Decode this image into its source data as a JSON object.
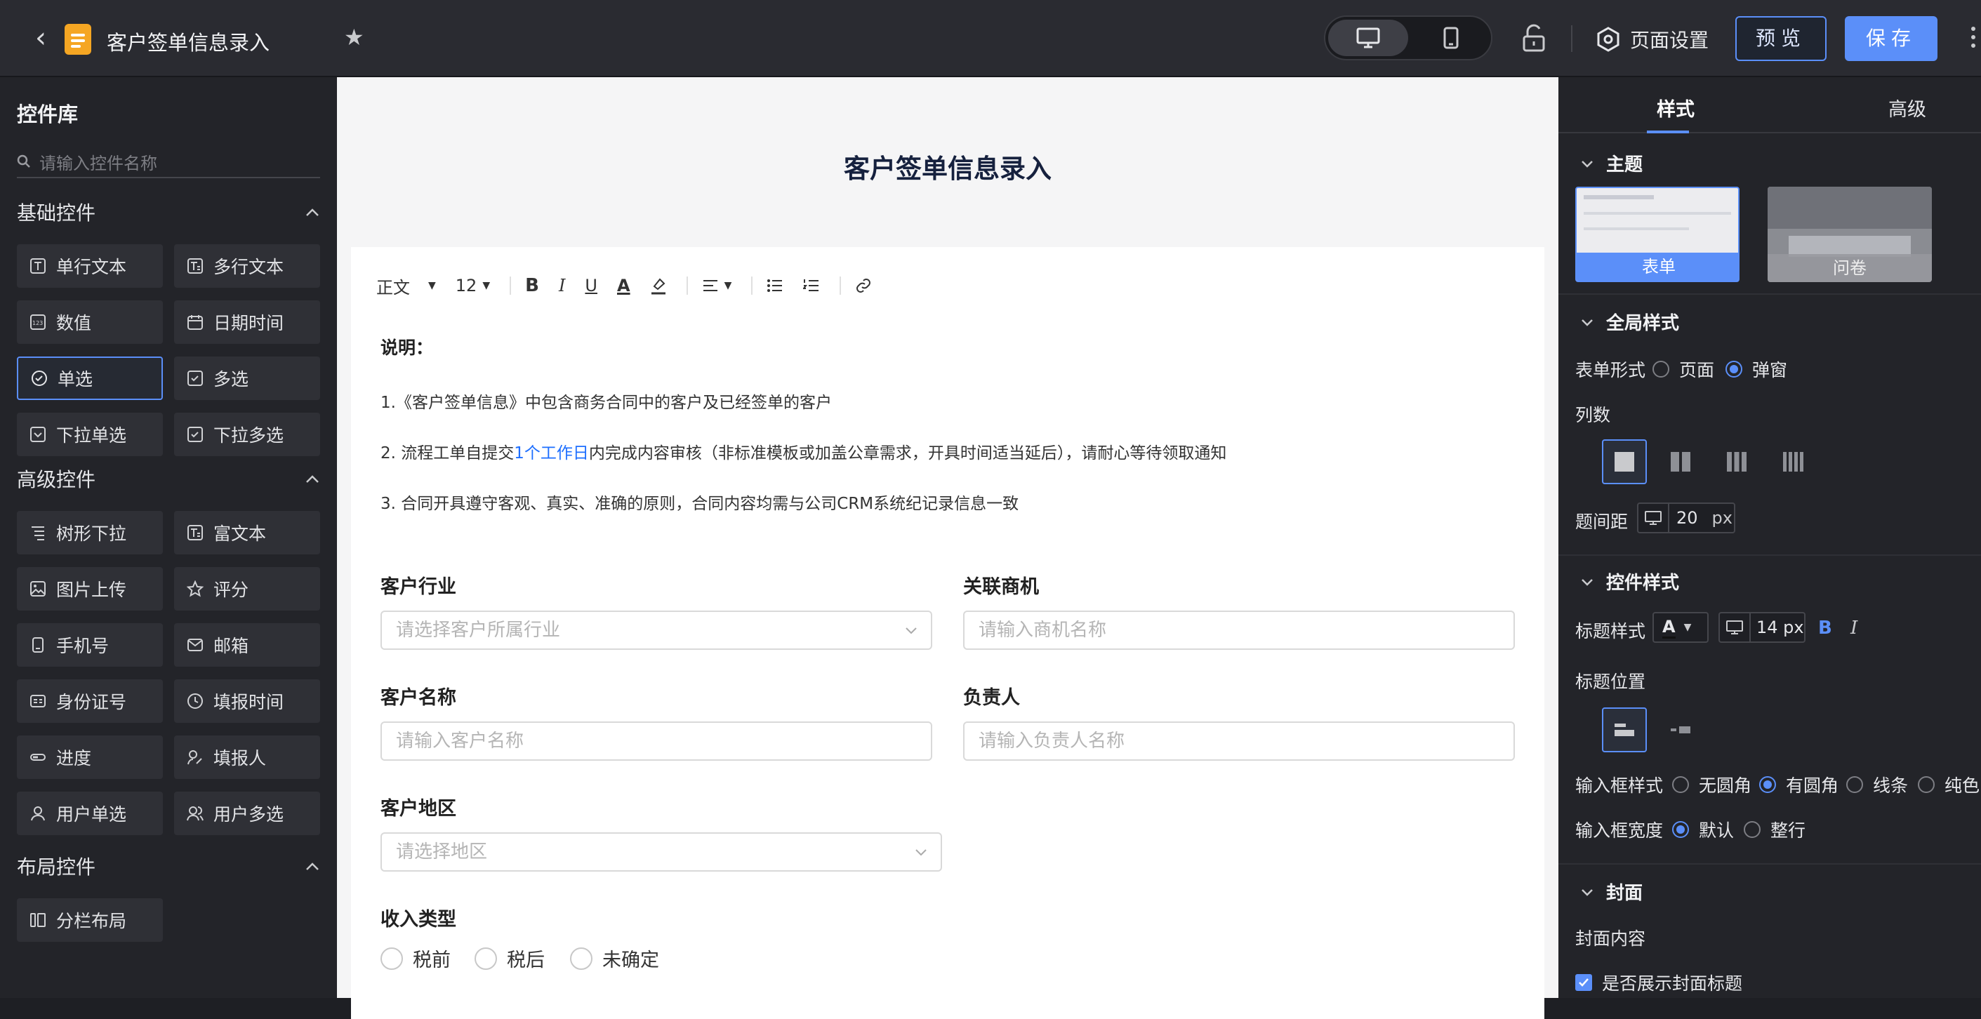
{
  "header": {
    "title": "客户签单信息录入",
    "page_settings": "页面设置",
    "preview": "预览",
    "save": "保存"
  },
  "library": {
    "title": "控件库",
    "search_placeholder": "请输入控件名称",
    "basic": {
      "title": "基础控件",
      "items": [
        "单行文本",
        "多行文本",
        "数值",
        "日期时间",
        "单选",
        "多选",
        "下拉单选",
        "下拉多选"
      ]
    },
    "advanced": {
      "title": "高级控件",
      "items": [
        "树形下拉",
        "富文本",
        "图片上传",
        "评分",
        "手机号",
        "邮箱",
        "身份证号",
        "填报时间",
        "进度",
        "填报人",
        "用户单选",
        "用户多选"
      ]
    },
    "layout": {
      "title": "布局控件",
      "items": [
        "分栏布局"
      ]
    }
  },
  "form": {
    "title": "客户签单信息录入",
    "toolbar": {
      "style": "正文",
      "size": "12",
      "bold": "B",
      "italic": "I",
      "underline": "U",
      "color": "A"
    },
    "notes": {
      "heading": "说明：",
      "line1": "1.《客户签单信息》中包含商务合同中的客户及已经签单的客户",
      "line2_a": "2. 流程工单自提交",
      "line2_hl": "1个工作日",
      "line2_b": "内完成内容审核（非标准模板或加盖公章需求，开具时间适当延后），请耐心等待领取通知",
      "line3": "3. 合同开具遵守客观、真实、准确的原则，合同内容均需与公司CRM系统纪记录信息一致"
    },
    "fields": {
      "industry": {
        "label": "客户行业",
        "placeholder": "请选择客户所属行业"
      },
      "opportunity": {
        "label": "关联商机",
        "placeholder": "请输入商机名称"
      },
      "name": {
        "label": "客户名称",
        "placeholder": "请输入客户名称"
      },
      "owner": {
        "label": "负责人",
        "placeholder": "请输入负责人名称"
      },
      "region": {
        "label": "客户地区",
        "placeholder": "请选择地区"
      },
      "income": {
        "label": "收入类型",
        "options": [
          "税前",
          "税后",
          "未确定"
        ]
      }
    }
  },
  "props": {
    "tabs": [
      "样式",
      "高级"
    ],
    "theme": {
      "title": "主题",
      "options": [
        "表单",
        "问卷"
      ]
    },
    "global": {
      "title": "全局样式",
      "form_type_label": "表单形式",
      "form_type_options": [
        "页面",
        "弹窗"
      ],
      "columns_label": "列数",
      "gap_label": "题间距",
      "gap_value": "20",
      "gap_unit": "px"
    },
    "control": {
      "title": "控件样式",
      "title_style_label": "标题样式",
      "title_font_letter": "A",
      "title_size": "14 px",
      "bold": "B",
      "italic": "I",
      "title_pos_label": "标题位置",
      "input_style_label": "输入框样式",
      "input_style_options": [
        "无圆角",
        "有圆角",
        "线条",
        "纯色"
      ],
      "input_width_label": "输入框宽度",
      "input_width_options": [
        "默认",
        "整行"
      ]
    },
    "cover": {
      "title": "封面",
      "content_label": "封面内容",
      "show_title": "是否展示封面标题"
    }
  }
}
